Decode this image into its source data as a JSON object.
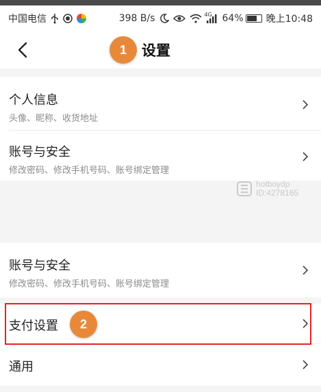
{
  "status_bar": {
    "carrier": "中国电信",
    "speed": "398 B/s",
    "network": "4G",
    "battery": "64%",
    "time": "晚上10:48"
  },
  "nav": {
    "title": "设置"
  },
  "annotations": {
    "step1": "1",
    "step2": "2"
  },
  "watermark": {
    "line1": "hotboydp",
    "line2": "ID:4278165"
  },
  "settings": {
    "personal": {
      "title": "个人信息",
      "subtitle": "头像、昵称、收货地址"
    },
    "account_top": {
      "title": "账号与安全",
      "subtitle": "修改密码、修改手机号码、账号绑定管理"
    },
    "account": {
      "title": "账号与安全",
      "subtitle": "修改密码、修改手机号码、账号绑定管理"
    },
    "payment": {
      "title": "支付设置"
    },
    "general": {
      "title": "通用"
    }
  },
  "colors": {
    "badge": "#e8893a",
    "highlight": "#e32323"
  }
}
